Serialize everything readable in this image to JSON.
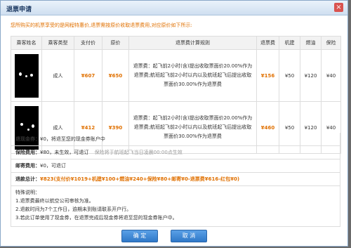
{
  "dialog": {
    "title": "退票申请",
    "close": "×"
  },
  "notice": "您所购买的机票享受的是网程特惠价,退票需按原价收取退票费用,对应原价如下所示:",
  "columns": [
    "乘客姓名",
    "乘客类型",
    "支付价",
    "原价",
    "退票费计算规则",
    "退票费",
    "机建",
    "燃油",
    "保险"
  ],
  "passengers": [
    {
      "type": "成人",
      "paid": "¥607",
      "original": "¥650",
      "rule": "退票费：起飞前2小时(含)提出收取票面价20.00%作为退票费;航班起飞前2小时以内以及航班起飞后提出收取票面价30.00%作为退票费",
      "fee": "¥156",
      "airport": "¥50",
      "fuel": "¥120",
      "insurance": "¥40"
    },
    {
      "type": "成人",
      "paid": "¥412",
      "original": "¥390",
      "rule": "退票费：起飞前2小时(含)提出收取票面价20.00%作为退票费;航班起飞前2小时以内以及航班起飞后提出收取票面价30.00%作为退票费",
      "fee": "¥460",
      "airport": "¥50",
      "fuel": "¥120",
      "insurance": "¥40"
    }
  ],
  "summary": {
    "refund_label": "退现金券：",
    "refund_text": "¥0，将退至您的现金券账户中",
    "insurance_label": "保险费用：",
    "insurance_text": "¥80，未生效，可退订",
    "insurance_hint": "保险将于航班起飞当日凌晨00:00点生效",
    "postage_label": "邮寄费用：",
    "postage_text": "¥0，可退订",
    "total_label": "退款总计：",
    "total_text": "¥823(支付价¥1019+机建¥100+燃油¥240+保险¥80+邮寄¥0-退票费¥616-红包¥0)"
  },
  "notes": {
    "title": "特殊说明：",
    "lines": [
      "1.退票费最终以航空公司审核为准。",
      "2.退款时间为7个工作日，逾期未到账请联系开户行。",
      "3.若此订单使用了现金券，在退票完成后现金券将退至您的现金券账户中。"
    ]
  },
  "buttons": {
    "confirm": "确 定",
    "cancel": "取 消"
  },
  "colors": {
    "accent": "#e07000",
    "button": "#2f78c8",
    "header": "#cfdff0"
  }
}
